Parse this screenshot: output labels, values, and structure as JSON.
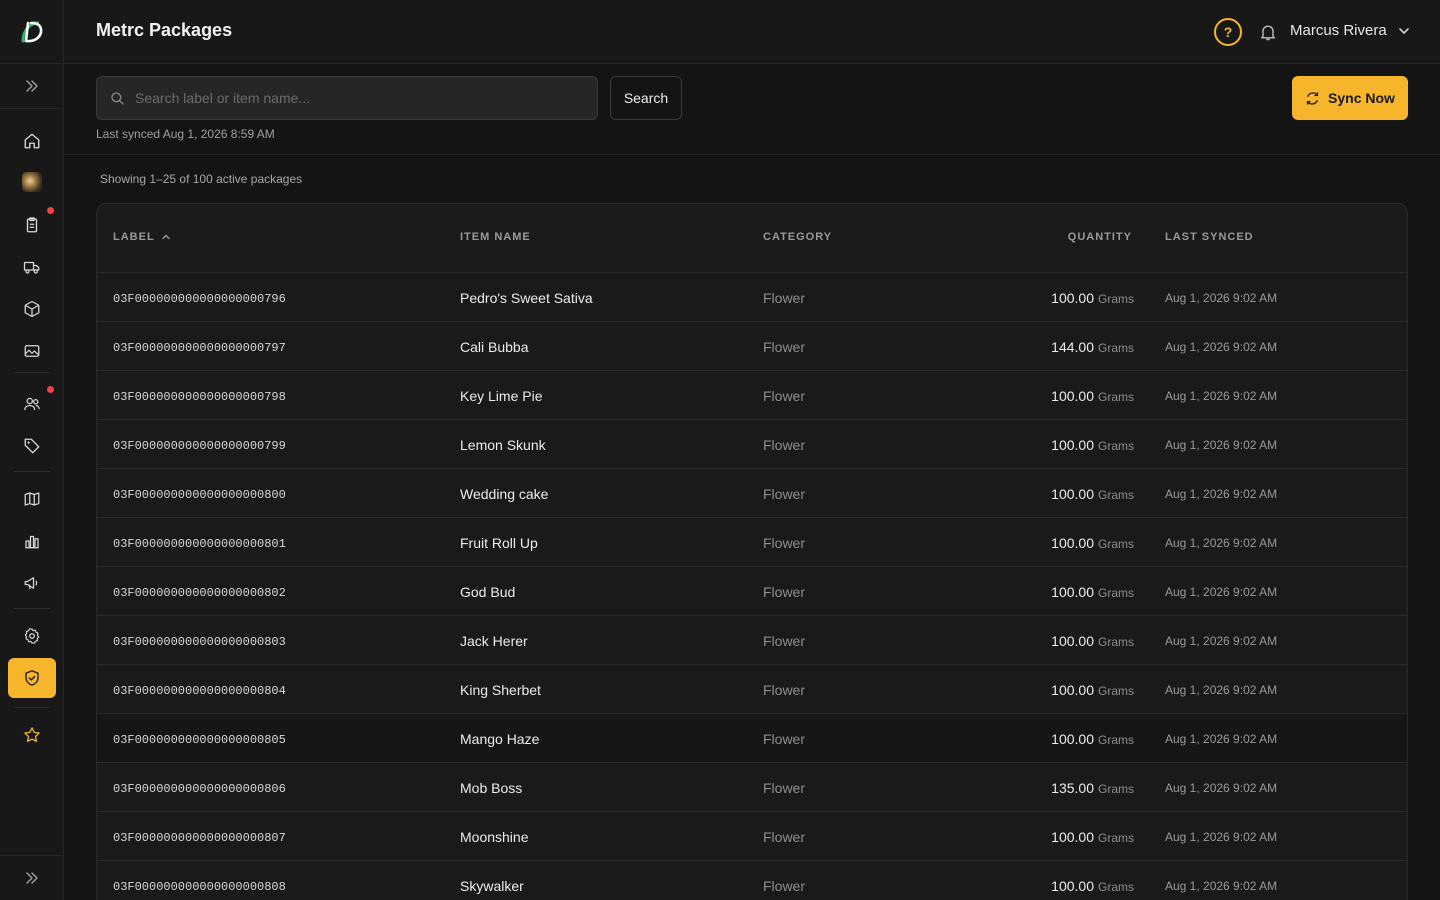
{
  "header": {
    "title": "Metrc Packages",
    "help_icon": "question-circle-icon",
    "user_name": "Marcus Rivera"
  },
  "toolbar": {
    "search_placeholder": "Search label or item name...",
    "search_label": "Search",
    "sync_label": "Sync Now",
    "last_synced": "Last synced Aug 1, 2026 8:59 AM"
  },
  "summary": "Showing 1–25 of 100 active packages",
  "sidebar": {
    "items": [
      "home-icon",
      "product-thumbnail",
      "clipboard-icon",
      "truck-icon",
      "package-icon",
      "image-icon",
      "users-icon",
      "tag-icon",
      "map-icon",
      "bar-chart-icon",
      "megaphone-icon",
      "settings-icon",
      "shield-check-icon",
      "star-icon"
    ],
    "badges": [
      "clipboard-icon",
      "users-icon"
    ],
    "active": "shield-check-icon",
    "accent": "#f6b52b",
    "badge_color": "#ef4444"
  },
  "table": {
    "columns": {
      "label": "LABEL",
      "item": "ITEM NAME",
      "category": "CATEGORY",
      "quantity": "QUANTITY",
      "synced": "LAST SYNCED"
    },
    "rows": [
      {
        "label": "03F000000000000000000796",
        "item": "Pedro's Sweet Sativa",
        "category": "Flower",
        "qty": "100.00",
        "unit": "Grams",
        "synced": "Aug 1, 2026 9:02 AM"
      },
      {
        "label": "03F000000000000000000797",
        "item": "Cali Bubba",
        "category": "Flower",
        "qty": "144.00",
        "unit": "Grams",
        "synced": "Aug 1, 2026 9:02 AM"
      },
      {
        "label": "03F000000000000000000798",
        "item": "Key Lime Pie",
        "category": "Flower",
        "qty": "100.00",
        "unit": "Grams",
        "synced": "Aug 1, 2026 9:02 AM"
      },
      {
        "label": "03F000000000000000000799",
        "item": "Lemon Skunk",
        "category": "Flower",
        "qty": "100.00",
        "unit": "Grams",
        "synced": "Aug 1, 2026 9:02 AM"
      },
      {
        "label": "03F000000000000000000800",
        "item": "Wedding cake",
        "category": "Flower",
        "qty": "100.00",
        "unit": "Grams",
        "synced": "Aug 1, 2026 9:02 AM"
      },
      {
        "label": "03F000000000000000000801",
        "item": "Fruit Roll Up",
        "category": "Flower",
        "qty": "100.00",
        "unit": "Grams",
        "synced": "Aug 1, 2026 9:02 AM"
      },
      {
        "label": "03F000000000000000000802",
        "item": "God Bud",
        "category": "Flower",
        "qty": "100.00",
        "unit": "Grams",
        "synced": "Aug 1, 2026 9:02 AM"
      },
      {
        "label": "03F000000000000000000803",
        "item": "Jack Herer",
        "category": "Flower",
        "qty": "100.00",
        "unit": "Grams",
        "synced": "Aug 1, 2026 9:02 AM"
      },
      {
        "label": "03F000000000000000000804",
        "item": "King Sherbet",
        "category": "Flower",
        "qty": "100.00",
        "unit": "Grams",
        "synced": "Aug 1, 2026 9:02 AM"
      },
      {
        "label": "03F000000000000000000805",
        "item": "Mango Haze",
        "category": "Flower",
        "qty": "100.00",
        "unit": "Grams",
        "synced": "Aug 1, 2026 9:02 AM"
      },
      {
        "label": "03F000000000000000000806",
        "item": "Mob Boss",
        "category": "Flower",
        "qty": "135.00",
        "unit": "Grams",
        "synced": "Aug 1, 2026 9:02 AM"
      },
      {
        "label": "03F000000000000000000807",
        "item": "Moonshine",
        "category": "Flower",
        "qty": "100.00",
        "unit": "Grams",
        "synced": "Aug 1, 2026 9:02 AM"
      },
      {
        "label": "03F000000000000000000808",
        "item": "Skywalker",
        "category": "Flower",
        "qty": "100.00",
        "unit": "Grams",
        "synced": "Aug 1, 2026 9:02 AM"
      }
    ]
  }
}
